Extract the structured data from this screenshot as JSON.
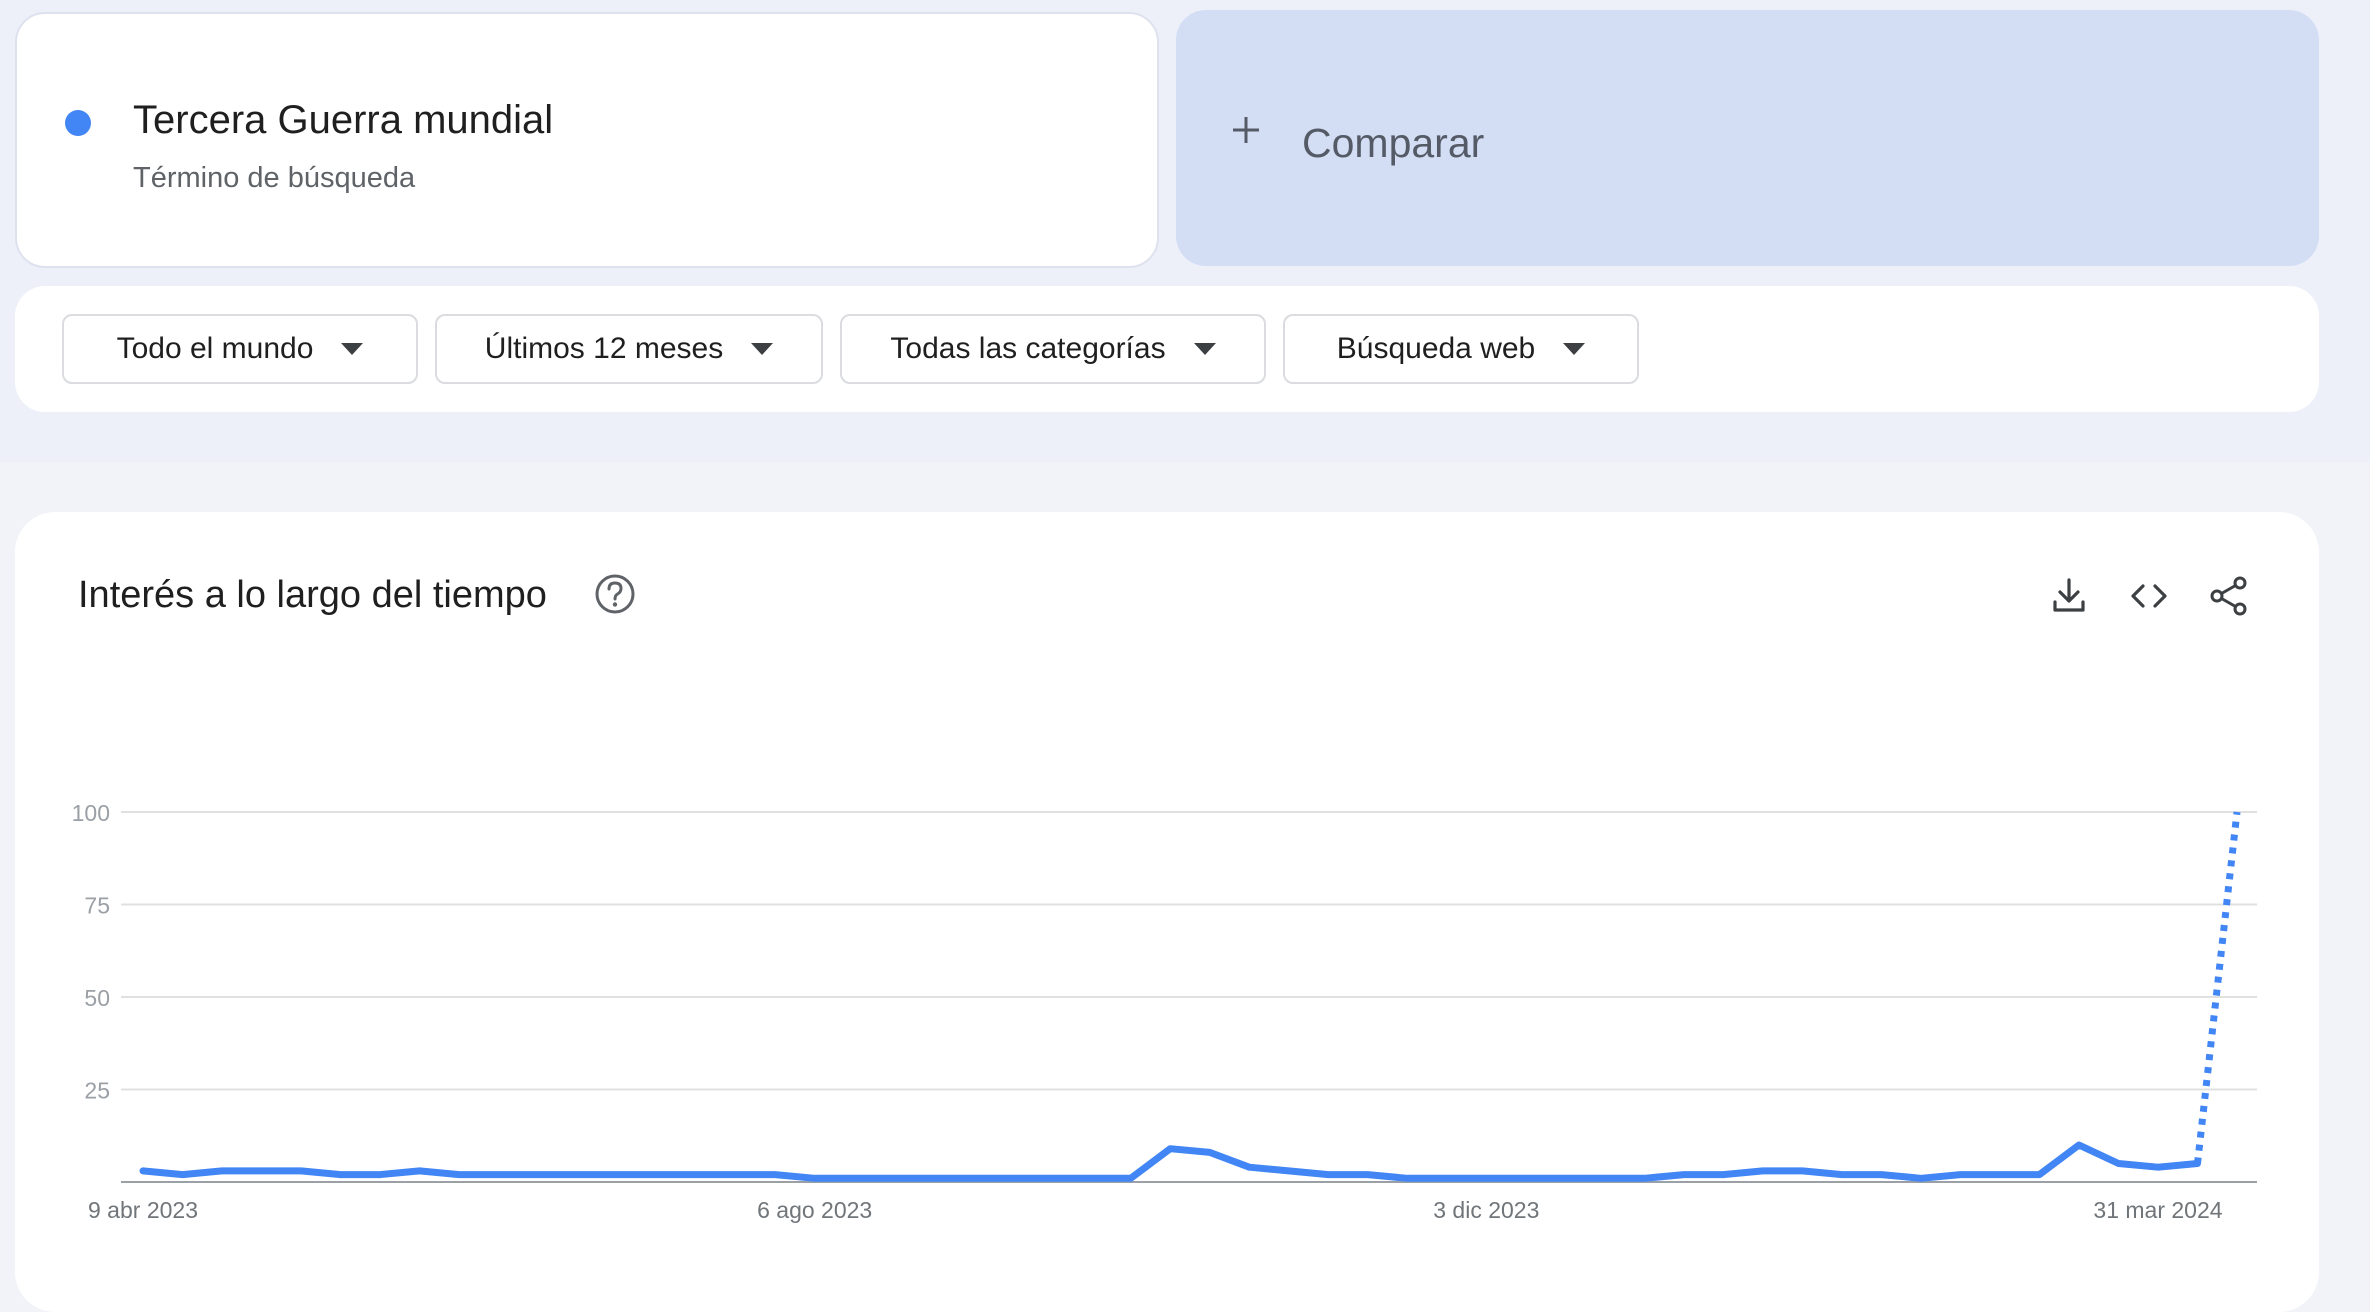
{
  "term": {
    "name": "Tercera Guerra mundial",
    "subtitle": "Término de búsqueda",
    "color": "#4285f4"
  },
  "compare": {
    "label": "Comparar",
    "icon": "plus-icon"
  },
  "filters": [
    {
      "label": "Todo el mundo"
    },
    {
      "label": "Últimos 12 meses"
    },
    {
      "label": "Todas las categorías"
    },
    {
      "label": "Búsqueda web"
    }
  ],
  "panel": {
    "title": "Interés a lo largo del tiempo",
    "help_icon": "help-circle-icon",
    "tools": [
      "download-icon",
      "embed-code-icon",
      "share-icon"
    ]
  },
  "chart_data": {
    "type": "line",
    "ylim": [
      0,
      100
    ],
    "yticks": [
      25,
      50,
      75,
      100
    ],
    "xtick_labels": [
      "9 abr 2023",
      "6 ago 2023",
      "3 dic 2023",
      "31 mar 2024"
    ],
    "xtick_index": [
      0,
      17,
      34,
      51
    ],
    "grid": true,
    "series": [
      {
        "color": "#4285f4",
        "values": [
          3,
          2,
          3,
          3,
          3,
          2,
          2,
          3,
          2,
          2,
          2,
          2,
          2,
          2,
          2,
          2,
          2,
          1,
          1,
          1,
          1,
          1,
          1,
          1,
          1,
          1,
          9,
          8,
          4,
          3,
          2,
          2,
          1,
          1,
          1,
          1,
          1,
          1,
          1,
          2,
          2,
          3,
          3,
          2,
          2,
          1,
          2,
          2,
          2,
          10,
          5,
          4,
          5,
          100
        ],
        "partial_from_index": 52
      }
    ]
  }
}
